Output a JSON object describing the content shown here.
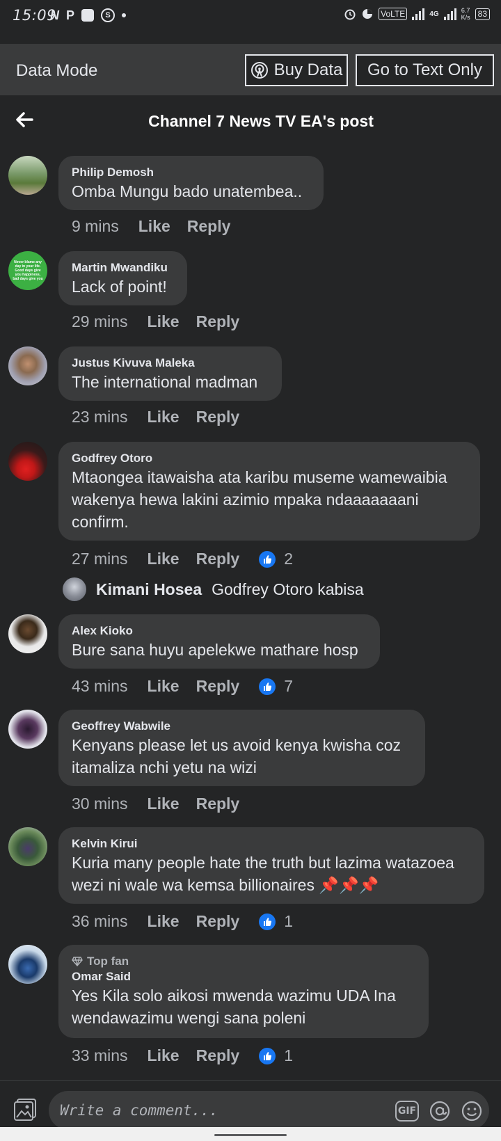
{
  "status_bar": {
    "time": "15:09",
    "left_icons": [
      "netflix-icon",
      "p-icon",
      "app-square-icon",
      "shazam-icon",
      "dot-icon"
    ],
    "volte": "VoLTE",
    "network": "4G",
    "speed_value": "6.7",
    "speed_unit": "K/s",
    "battery": "83"
  },
  "data_mode": {
    "label": "Data Mode",
    "buy_data_label": "Buy Data",
    "text_only_label": "Go to Text Only"
  },
  "header": {
    "title": "Channel 7 News TV EA's post"
  },
  "comments": [
    {
      "name": "Philip Demosh",
      "text": "Omba Mungu bado unatembea..",
      "time": "9 mins",
      "like": "Like",
      "reply": "Reply"
    },
    {
      "name": "Martin Mwandiku",
      "text": "Lack of point!",
      "time": "29 mins",
      "like": "Like",
      "reply": "Reply",
      "avatar_text": "Never blame any day in your life. Good days give you happiness, bad days give you"
    },
    {
      "name": "Justus Kivuva Maleka",
      "text": "The international madman",
      "time": "23 mins",
      "like": "Like",
      "reply": "Reply"
    },
    {
      "name": "Godfrey Otoro",
      "text": "Mtaongea itawaisha ata karibu museme wamewaibia wakenya hewa lakini azimio mpaka ndaaaaaaani confirm.",
      "time": "27 mins",
      "like": "Like",
      "reply": "Reply",
      "likes": "2"
    },
    {
      "name": "Alex Kioko",
      "text": "Bure sana huyu apelekwe mathare hosp",
      "time": "43 mins",
      "like": "Like",
      "reply": "Reply",
      "likes": "7"
    },
    {
      "name": "Geoffrey Wabwile",
      "text": "Kenyans please let us avoid kenya kwisha coz itamaliza nchi yetu na wizi",
      "time": "30 mins",
      "like": "Like",
      "reply": "Reply"
    },
    {
      "name": "Kelvin Kirui",
      "text": "Kuria many people hate the truth but lazima watazoea wezi ni wale wa kemsa billionaires 📌📌📌",
      "time": "36 mins",
      "like": "Like",
      "reply": "Reply",
      "likes": "1"
    },
    {
      "name": "Omar Said",
      "badge": "Top fan",
      "text": "Yes Kila  solo aikosi mwenda wazimu UDA Ina wendawazimu wengi sana poleni",
      "time": "33 mins",
      "like": "Like",
      "reply": "Reply",
      "likes": "1"
    }
  ],
  "reply_preview": {
    "name": "Kimani Hosea",
    "text": "Godfrey Otoro kabisa"
  },
  "composer": {
    "placeholder": "Write a comment...",
    "gif_label": "GIF"
  },
  "colors": {
    "background": "#242526",
    "bubble": "#3a3b3c",
    "like_blue": "#1877f2",
    "secondary_text": "#b0b3b8"
  }
}
